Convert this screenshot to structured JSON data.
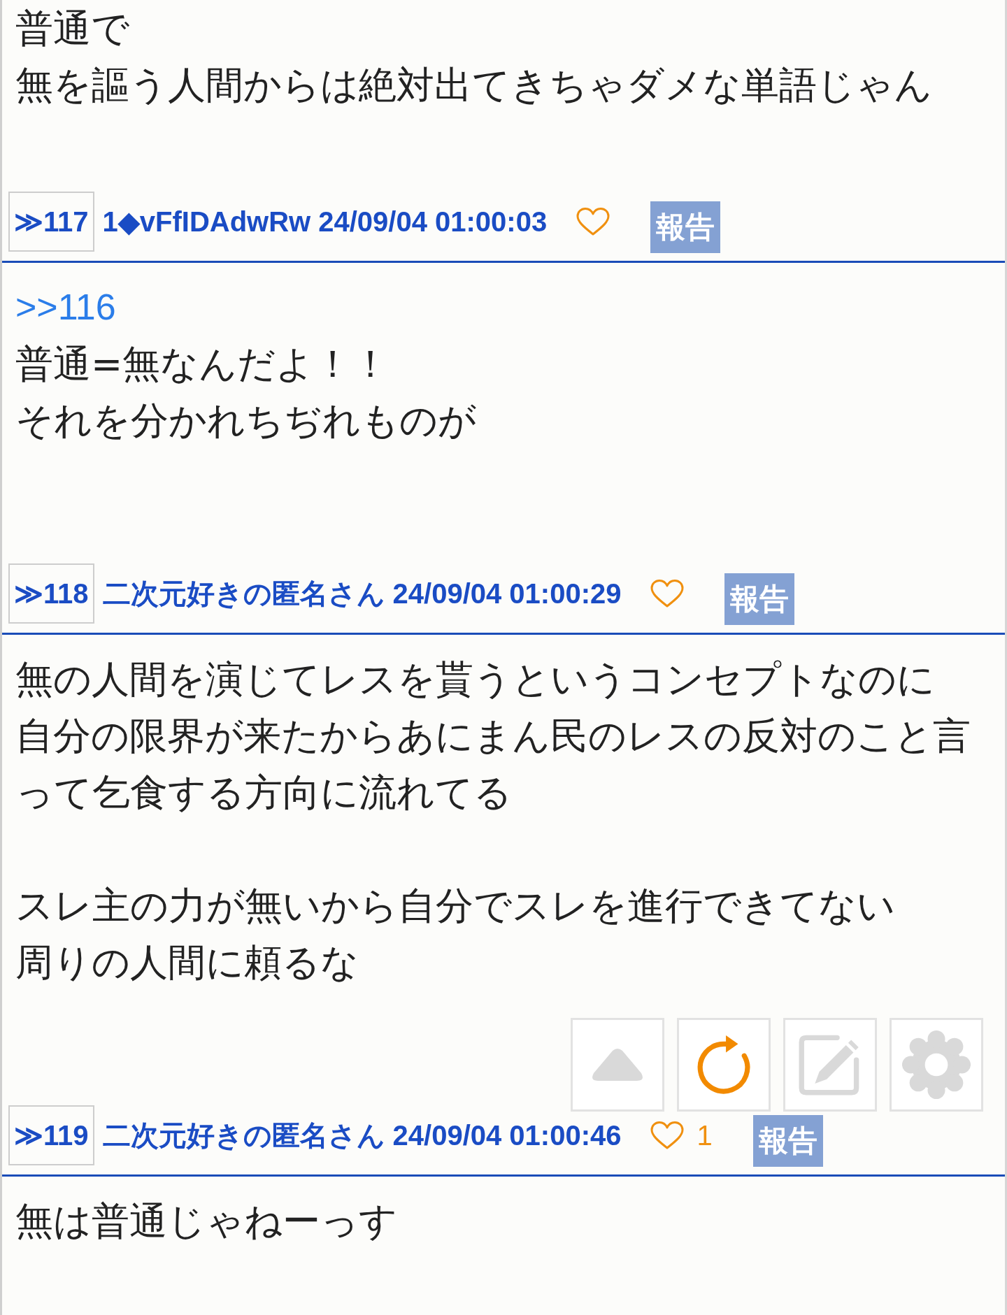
{
  "posts": [
    {
      "paragraphs": [
        [
          "普通で",
          "無を謳う人間からは絶対出てきちゃダメな単語じゃん"
        ]
      ]
    },
    {
      "number": "≫117",
      "author": "1◆vFfIDAdwRw",
      "datetime": "24/09/04 01:00:03",
      "report_label": "報告",
      "reply_to": ">>116",
      "paragraphs": [
        [
          "普通=無なんだよ！！",
          "それを分かれちぢれものが"
        ]
      ]
    },
    {
      "number": "≫118",
      "author": "二次元好きの匿名さん",
      "datetime": "24/09/04 01:00:29",
      "report_label": "報告",
      "paragraphs": [
        [
          "無の人間を演じてレスを貰うというコンセプトなのに",
          "自分の限界が来たからあにまん民のレスの反対のこと言って乞食する方向に流れてる"
        ],
        [
          "スレ主の力が無いから自分でスレを進行できてない",
          "周りの人間に頼るな"
        ]
      ]
    },
    {
      "number": "≫119",
      "author": "二次元好きの匿名さん",
      "datetime": "24/09/04 01:00:46",
      "like_count": "1",
      "report_label": "報告",
      "paragraphs": [
        [
          "無は普通じゃねーっす"
        ]
      ]
    }
  ],
  "floating_buttons": [
    {
      "kind": "scroll_top"
    },
    {
      "kind": "reload"
    },
    {
      "kind": "write"
    },
    {
      "kind": "settings"
    }
  ]
}
